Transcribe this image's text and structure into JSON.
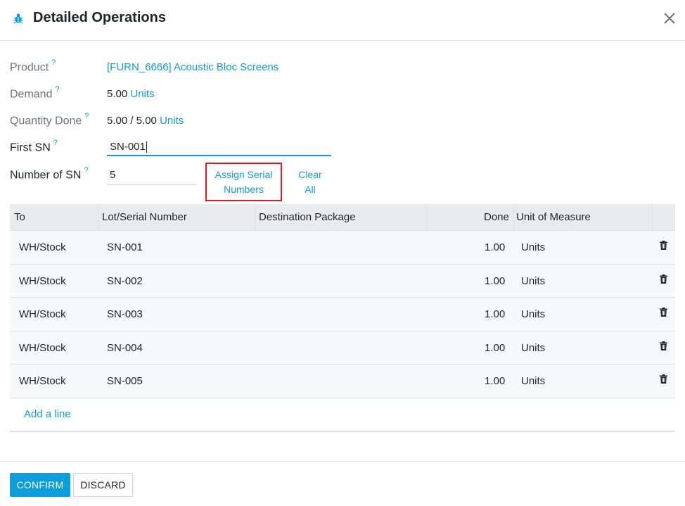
{
  "dialog": {
    "title": "Detailed Operations",
    "close_label": "×"
  },
  "form": {
    "product": {
      "label": "Product",
      "help": "?",
      "value": "[FURN_6666] Acoustic Bloc Screens"
    },
    "demand": {
      "label": "Demand",
      "help": "?",
      "qty": "5.00",
      "uom": "Units"
    },
    "quantity_done": {
      "label": "Quantity Done",
      "help": "?",
      "qty": "5.00 / 5.00",
      "uom": "Units"
    },
    "first_sn": {
      "label": "First SN",
      "help": "?",
      "value": "SN-001"
    },
    "number_of_sn": {
      "label": "Number of SN",
      "help": "?",
      "value": "5"
    },
    "assign_button": {
      "line1": "Assign Serial",
      "line2": "Numbers"
    },
    "clear_button": {
      "line1": "Clear",
      "line2": "All"
    }
  },
  "table": {
    "headers": [
      "To",
      "Lot/Serial Number",
      "Destination Package",
      "Done",
      "Unit of Measure"
    ],
    "rows": [
      {
        "to": "WH/Stock",
        "lot": "SN-001",
        "package": "",
        "done": "1.00",
        "uom": "Units"
      },
      {
        "to": "WH/Stock",
        "lot": "SN-002",
        "package": "",
        "done": "1.00",
        "uom": "Units"
      },
      {
        "to": "WH/Stock",
        "lot": "SN-003",
        "package": "",
        "done": "1.00",
        "uom": "Units"
      },
      {
        "to": "WH/Stock",
        "lot": "SN-004",
        "package": "",
        "done": "1.00",
        "uom": "Units"
      },
      {
        "to": "WH/Stock",
        "lot": "SN-005",
        "package": "",
        "done": "1.00",
        "uom": "Units"
      }
    ],
    "add_line": "Add a line"
  },
  "footer": {
    "confirm": "CONFIRM",
    "discard": "DISCARD"
  },
  "colors": {
    "accent": "#0d9ddb",
    "highlight": "#e31b23"
  },
  "icons": {
    "header": "bug-icon",
    "close": "close-icon",
    "row_action": "trash-icon"
  }
}
